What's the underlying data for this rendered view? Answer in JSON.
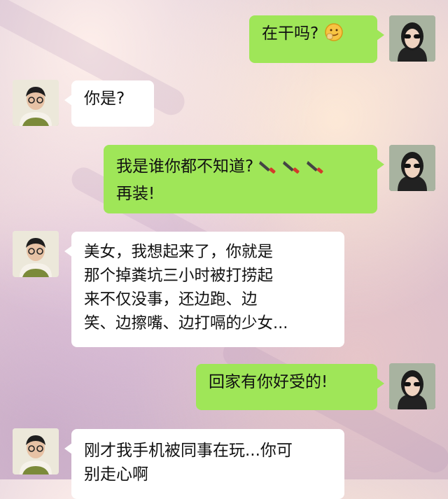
{
  "messages": [
    {
      "sender": "me",
      "lines": [
        "在干吗?"
      ],
      "emoji": "blush-hand-emoji"
    },
    {
      "sender": "other",
      "lines": [
        "你是?"
      ]
    },
    {
      "sender": "me",
      "lines": [
        "我是谁你都不知道?",
        "再装!"
      ],
      "emoji": "knife-emoji"
    },
    {
      "sender": "other",
      "lines": [
        "美女，我想起来了，你就是",
        "那个掉粪坑三小时被打捞起",
        "来不仅没事，还边跑、边",
        "笑、边擦嘴、边打嗝的少女..."
      ]
    },
    {
      "sender": "me",
      "lines": [
        "回家有你好受的!"
      ]
    },
    {
      "sender": "other",
      "lines": [
        "刚才我手机被同事在玩...你可",
        "别走心啊"
      ]
    }
  ],
  "colors": {
    "me_bubble": "#9fe658",
    "other_bubble": "#ffffff"
  }
}
